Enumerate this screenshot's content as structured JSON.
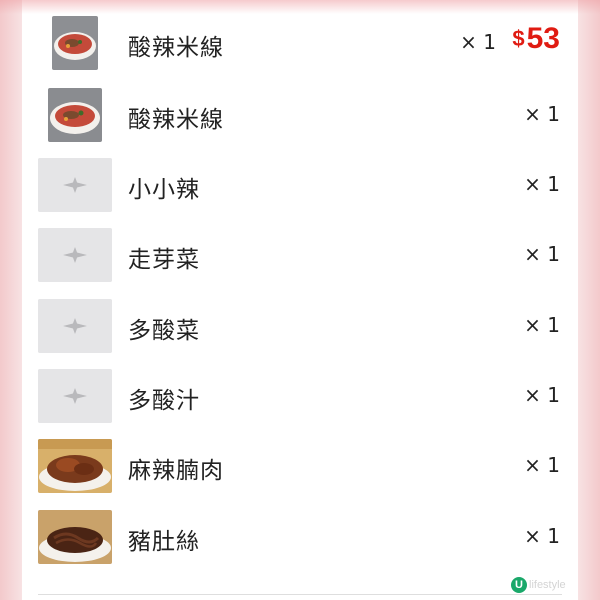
{
  "order": {
    "main_item": {
      "name": "酸辣米線",
      "qty": "× 1",
      "price_symbol": "$",
      "price_value": "53",
      "image": "noodle-bowl"
    },
    "items": [
      {
        "name": "酸辣米線",
        "qty": "× 1",
        "image": "noodle-bowl"
      },
      {
        "name": "小小辣",
        "qty": "× 1",
        "image": "placeholder"
      },
      {
        "name": "走芽菜",
        "qty": "× 1",
        "image": "placeholder"
      },
      {
        "name": "多酸菜",
        "qty": "× 1",
        "image": "placeholder"
      },
      {
        "name": "多酸汁",
        "qty": "× 1",
        "image": "placeholder"
      },
      {
        "name": "麻辣腩肉",
        "qty": "× 1",
        "image": "braised-pork"
      },
      {
        "name": "豬肚絲",
        "qty": "× 1",
        "image": "pork-tripe"
      }
    ]
  },
  "colors": {
    "price": "#e01b12",
    "placeholder_bg": "#e5e5e7",
    "brand_green": "#1aa86a"
  },
  "watermark": {
    "logo": "U",
    "text": "lifestyle"
  }
}
